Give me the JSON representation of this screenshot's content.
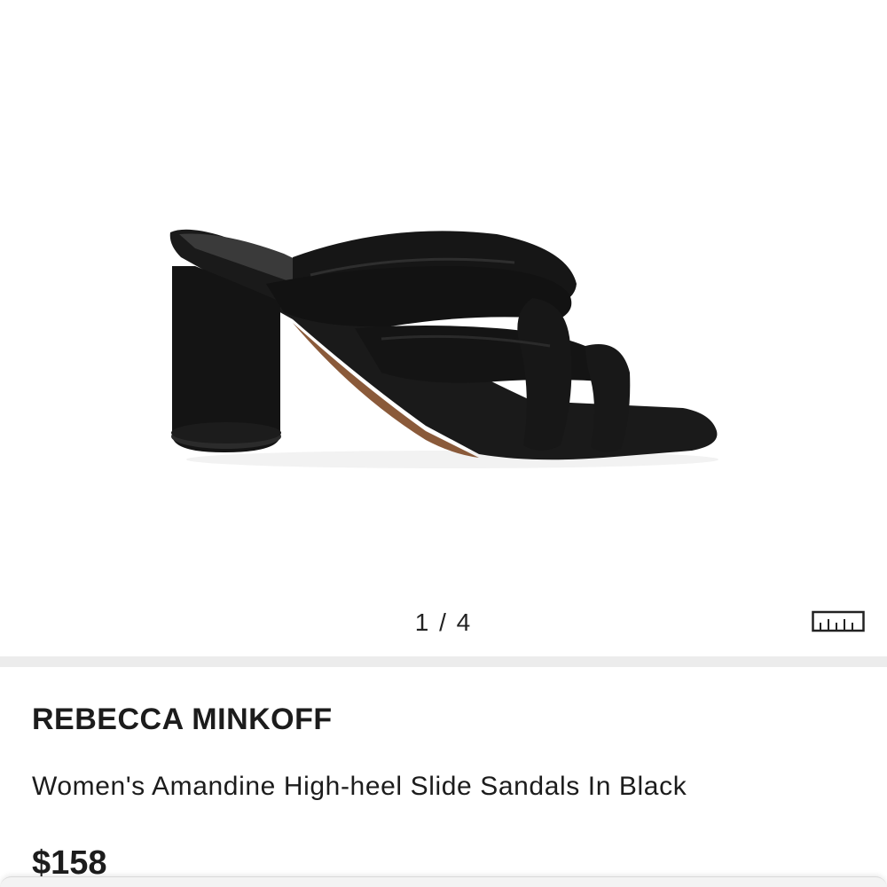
{
  "gallery": {
    "image_alt": "Women's Amandine High-heel Slide Sandals In Black",
    "pager_text": "1 / 4",
    "size_guide_icon": "ruler-icon"
  },
  "product": {
    "brand": "REBECCA MINKOFF",
    "title": "Women's Amandine High-heel Slide Sandals In Black",
    "price": "$158"
  },
  "colors": {
    "divider": "#ececec",
    "text": "#1c1c1c",
    "shoe": "#151515"
  }
}
